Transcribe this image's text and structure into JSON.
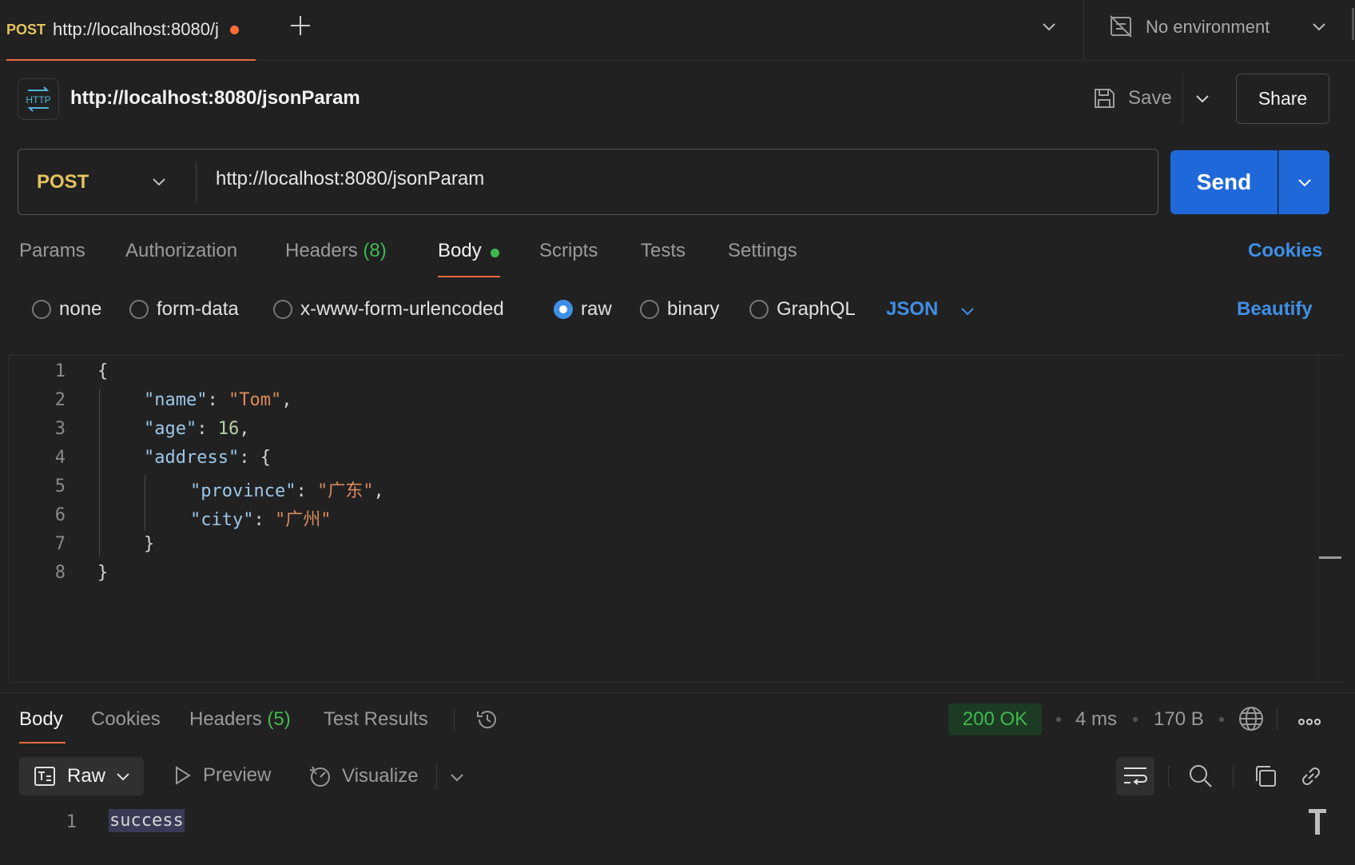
{
  "tab": {
    "method": "POST",
    "title": "http://localhost:8080/j"
  },
  "environment": {
    "label": "No environment"
  },
  "request": {
    "badge": "HTTP",
    "name": "http://localhost:8080/jsonParam",
    "save_label": "Save",
    "share_label": "Share",
    "method": "POST",
    "url": "http://localhost:8080/jsonParam",
    "send_label": "Send"
  },
  "request_tabs": {
    "params": "Params",
    "authorization": "Authorization",
    "headers": "Headers",
    "headers_count": "(8)",
    "body": "Body",
    "scripts": "Scripts",
    "tests": "Tests",
    "settings": "Settings",
    "cookies": "Cookies"
  },
  "body_types": {
    "options": [
      "none",
      "form-data",
      "x-www-form-urlencoded",
      "raw",
      "binary",
      "GraphQL"
    ],
    "selected": "raw",
    "format": "JSON",
    "beautify": "Beautify"
  },
  "editor": {
    "line_numbers": [
      "1",
      "2",
      "3",
      "4",
      "5",
      "6",
      "7",
      "8"
    ],
    "lines": [
      {
        "open": "{"
      },
      {
        "key": "\"name\"",
        "sep": ": ",
        "val": "\"Tom\"",
        "end": ","
      },
      {
        "key": "\"age\"",
        "sep": ": ",
        "num": "16",
        "end": ","
      },
      {
        "key": "\"address\"",
        "sep": ": ",
        "end": "{"
      },
      {
        "key": "\"province\"",
        "sep": ": ",
        "val": "\"广东\"",
        "end": ","
      },
      {
        "key": "\"city\"",
        "sep": ": ",
        "val": "\"广州\"",
        "end": ""
      },
      {
        "close": "}"
      },
      {
        "close": "}"
      }
    ]
  },
  "response": {
    "tabs": {
      "body": "Body",
      "cookies": "Cookies",
      "headers": "Headers",
      "headers_count": "(5)",
      "test_results": "Test Results"
    },
    "status": "200 OK",
    "time": "4 ms",
    "size": "170 B",
    "view_mode": "Raw",
    "preview": "Preview",
    "visualize": "Visualize",
    "line_number": "1",
    "content": "success"
  },
  "colors": {
    "accent": "#e8693d",
    "primary": "#1f68d9",
    "success": "#3fb950",
    "link": "#3f8fe6"
  }
}
